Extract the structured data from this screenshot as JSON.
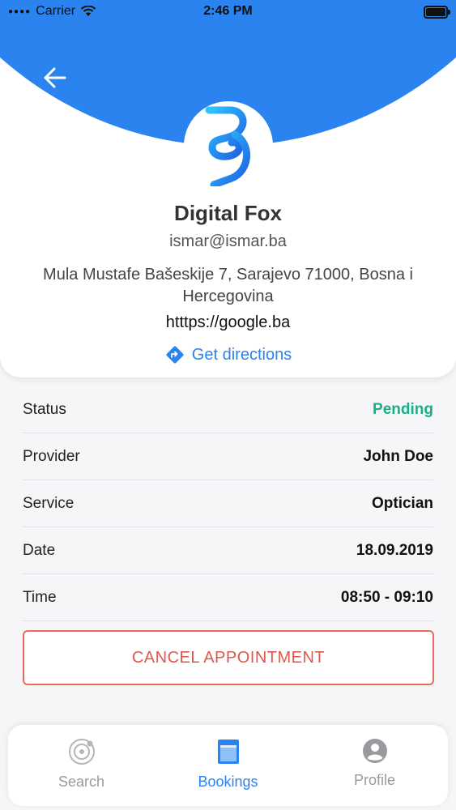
{
  "status_bar": {
    "carrier": "Carrier",
    "time": "2:46 PM"
  },
  "header": {
    "back_icon": "arrow-left-icon",
    "logo_icon": "brand-b-logo",
    "company_name": "Digital Fox",
    "email": "ismar@ismar.ba",
    "address": "Mula Mustafe Bašeskije 7, Sarajevo 71000, Bosna i Hercegovina",
    "website": "htttps://google.ba",
    "directions_label": "Get directions",
    "accent_color": "#2a83ee"
  },
  "details": [
    {
      "label": "Status",
      "value": "Pending",
      "status_color": "#1aaf8b"
    },
    {
      "label": "Provider",
      "value": "John Doe"
    },
    {
      "label": "Service",
      "value": "Optician"
    },
    {
      "label": "Date",
      "value": "18.09.2019"
    },
    {
      "label": "Time",
      "value": "08:50 - 09:10"
    }
  ],
  "cancel_button": {
    "label": "CANCEL APPOINTMENT",
    "color": "#e2574c"
  },
  "tab_bar": {
    "tabs": [
      {
        "label": "Search",
        "icon": "target-search-icon",
        "active": false
      },
      {
        "label": "Bookings",
        "icon": "bookings-calendar-icon",
        "active": true
      },
      {
        "label": "Profile",
        "icon": "user-profile-icon",
        "active": false
      }
    ]
  }
}
